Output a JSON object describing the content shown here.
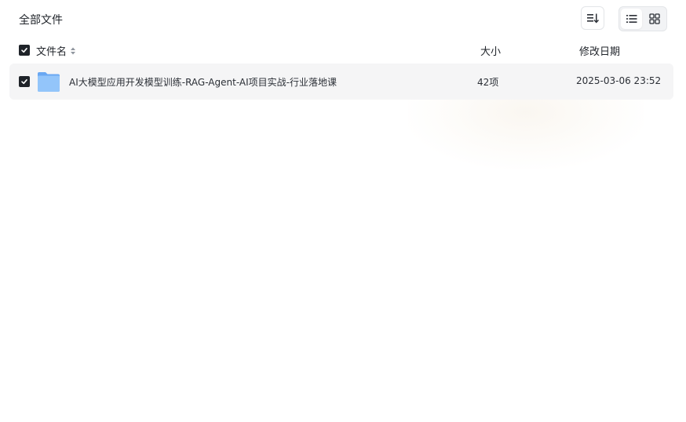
{
  "header": {
    "title": "全部文件"
  },
  "columns": {
    "name": "文件名",
    "size": "大小",
    "modified": "修改日期"
  },
  "files": [
    {
      "name": "AI大模型应用开发模型训练-RAG-Agent-AI项目实战-行业落地课",
      "size": "42项",
      "modified": "2025-03-06 23:52",
      "type": "folder",
      "checked": true
    }
  ],
  "icons": {
    "sort": "sort-icon",
    "list_view": "list-view-icon",
    "grid_view": "grid-view-icon",
    "folder": "folder-icon",
    "check": "check-icon"
  },
  "colors": {
    "checkbox": "#1f2329",
    "row_bg": "#f5f5f6",
    "folder_blue": "#7db5f5"
  }
}
